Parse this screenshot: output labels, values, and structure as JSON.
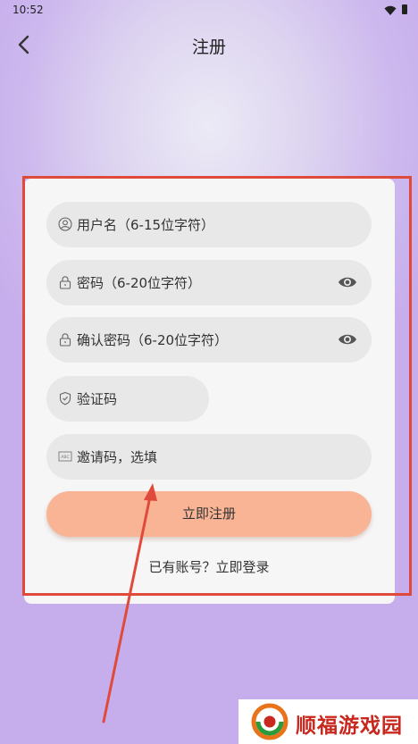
{
  "status_bar": {
    "time": "10:52"
  },
  "header": {
    "title": "注册"
  },
  "form": {
    "username_placeholder": "用户名（6-15位字符）",
    "password_placeholder": "密码（6-20位字符）",
    "confirm_placeholder": "确认密码（6-20位字符）",
    "code_placeholder": "验证码",
    "invite_placeholder": "邀请码，选填",
    "submit_label": "立即注册",
    "login_prompt": "已有账号？立即登录"
  },
  "icons": {
    "username": "user-icon",
    "password": "lock-icon",
    "confirm": "lock-icon",
    "code": "shield-icon",
    "invite": "abc-icon",
    "toggle": "eye-icon"
  },
  "colors": {
    "accent": "#f8b494",
    "highlight": "#e04a3a",
    "watermark": "#c8281e"
  },
  "watermark": {
    "text": "顺福游戏园"
  }
}
